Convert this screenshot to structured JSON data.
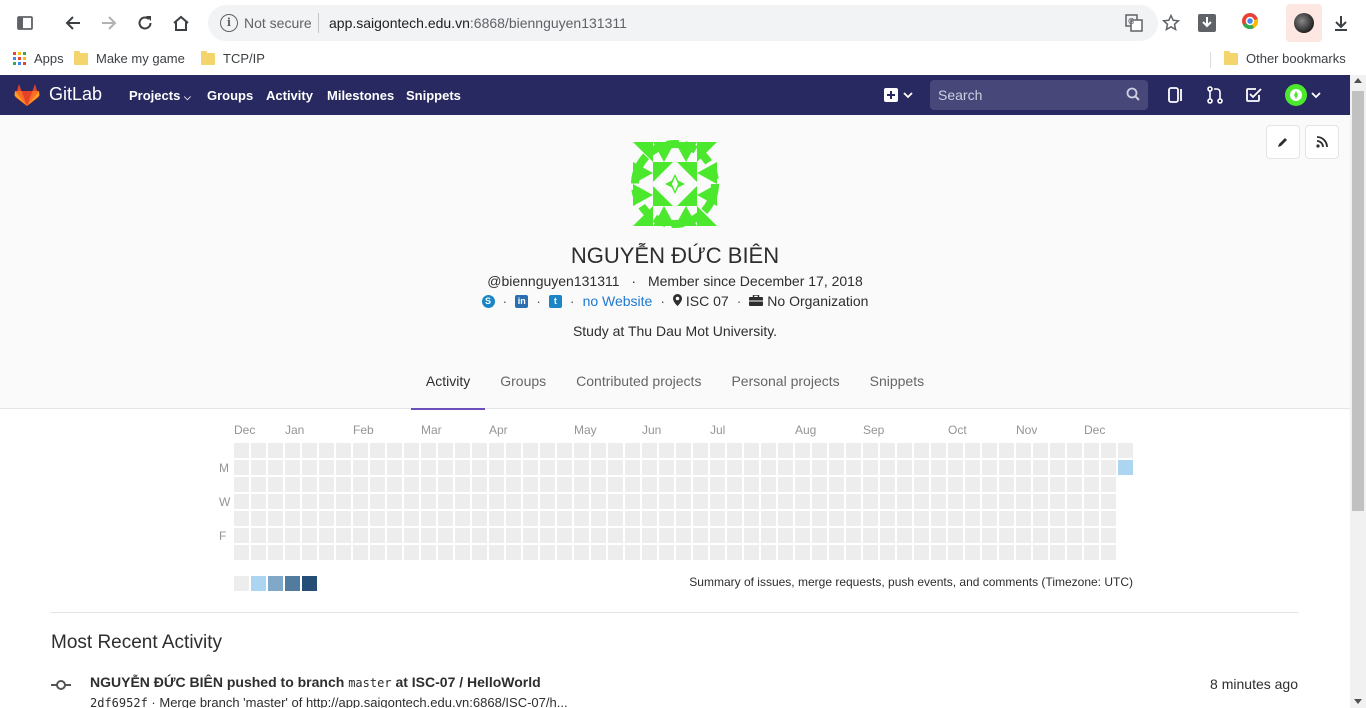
{
  "browser": {
    "not_secure": "Not secure",
    "url_host": "app.saigontech.edu.vn",
    "url_rest": ":6868/biennguyen131311"
  },
  "bookmarks": {
    "apps": "Apps",
    "items": [
      "Make my game",
      "TCP/IP"
    ],
    "other": "Other bookmarks"
  },
  "navbar": {
    "brand": "GitLab",
    "links": [
      "Projects",
      "Groups",
      "Activity",
      "Milestones",
      "Snippets"
    ],
    "search_placeholder": "Search",
    "color": "#292961"
  },
  "profile": {
    "name": "NGUYỄN ĐỨC BIÊN",
    "username": "@biennguyen131311",
    "member_since": "Member since December 17, 2018",
    "website": "no Website",
    "location": "ISC 07",
    "organization": "No Organization",
    "bio": "Study at Thu Dau Mot University.",
    "avatar_color": "#4be82e"
  },
  "tabs": [
    {
      "label": "Activity",
      "active": true
    },
    {
      "label": "Groups",
      "active": false
    },
    {
      "label": "Contributed projects",
      "active": false
    },
    {
      "label": "Personal projects",
      "active": false
    },
    {
      "label": "Snippets",
      "active": false
    }
  ],
  "calendar": {
    "months": [
      "Dec",
      "Jan",
      "Feb",
      "Mar",
      "Apr",
      "May",
      "Jun",
      "Jul",
      "Aug",
      "Sep",
      "Oct",
      "Nov",
      "Dec"
    ],
    "day_labels": [
      "M",
      "W",
      "F"
    ],
    "active_day": "M",
    "legend_colors": [
      "#ededed",
      "#acd5f2",
      "#7fa8c9",
      "#527ba0",
      "#254e77"
    ],
    "empty_color": "#ededed",
    "summary": "Summary of issues, merge requests, push events, and comments (Timezone: UTC)"
  },
  "recent": {
    "title": "Most Recent Activity",
    "event_author": "NGUYỄN ĐỨC BIÊN",
    "event_action": "pushed to branch",
    "event_branch": "master",
    "event_at": "at",
    "event_project": "ISC-07 / HelloWorld",
    "event_time": "8 minutes ago",
    "commit_sha": "2df6952f",
    "commit_message": "· Merge branch 'master' of http://app.saigontech.edu.vn:6868/ISC-07/h..."
  }
}
